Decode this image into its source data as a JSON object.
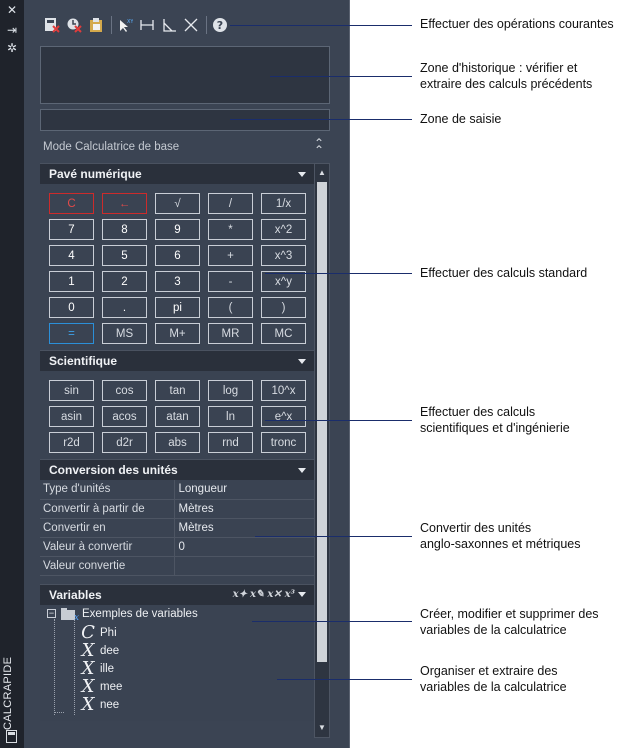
{
  "sidebar": {
    "vertical_title": "CALCRAPIDE",
    "icons": [
      "close-icon",
      "pin-icon",
      "gear-icon",
      "calculator-icon"
    ]
  },
  "toolbar": {
    "buttons": [
      "clear-icon",
      "clear-history-icon",
      "paste-icon",
      "get-coordinates-icon",
      "distance-icon",
      "angle-icon",
      "intersection-icon",
      "help-icon"
    ]
  },
  "history": {
    "value": ""
  },
  "input": {
    "value": ""
  },
  "mode_label": "Mode Calculatrice de base",
  "numpad": {
    "title": "Pavé numérique",
    "keys": [
      [
        "C",
        "←",
        "√",
        "/",
        "1/x"
      ],
      [
        "7",
        "8",
        "9",
        "*",
        "x^2"
      ],
      [
        "4",
        "5",
        "6",
        "+",
        "x^3"
      ],
      [
        "1",
        "2",
        "3",
        "-",
        "x^y"
      ],
      [
        "0",
        ".",
        "pi",
        "(",
        ")"
      ],
      [
        "=",
        "MS",
        "M+",
        "MR",
        "MC"
      ]
    ]
  },
  "scientific": {
    "title": "Scientifique",
    "keys": [
      [
        "sin",
        "cos",
        "tan",
        "log",
        "10^x"
      ],
      [
        "asin",
        "acos",
        "atan",
        "ln",
        "e^x"
      ],
      [
        "r2d",
        "d2r",
        "abs",
        "rnd",
        "tronc"
      ]
    ]
  },
  "units": {
    "title": "Conversion des unités",
    "rows": [
      {
        "label": "Type d'unités",
        "value": "Longueur"
      },
      {
        "label": "Convertir à partir de",
        "value": "Mètres"
      },
      {
        "label": "Convertir en",
        "value": "Mètres"
      },
      {
        "label": "Valeur à convertir",
        "value": "0"
      },
      {
        "label": "Valeur convertie",
        "value": ""
      }
    ]
  },
  "variables": {
    "title": "Variables",
    "category": "Exemples de variables",
    "items": [
      {
        "glyph": "C",
        "name": "Phi"
      },
      {
        "glyph": "X",
        "name": "dee"
      },
      {
        "glyph": "X",
        "name": "ille"
      },
      {
        "glyph": "X",
        "name": "mee"
      },
      {
        "glyph": "X",
        "name": "nee"
      }
    ]
  },
  "callouts": [
    "Effectuer des opérations courantes",
    "Zone d'historique : vérifier et\nextraire des calculs précédents",
    "Zone de saisie",
    "Effectuer des calculs standard",
    "Effectuer des calculs\nscientifiques et d'ingénierie",
    "Convertir des unités\nanglo-saxonnes et métriques",
    "Créer, modifier et supprimer des\nvariables de la calculatrice",
    "Organiser et extraire des\nvariables de la calculatrice"
  ],
  "colors": {
    "panel": "#3b4453",
    "strip": "#1f232b",
    "red_key": "#cc2b2b",
    "blue_key": "#2b8fd8",
    "callout_line": "#1a2d6b"
  }
}
